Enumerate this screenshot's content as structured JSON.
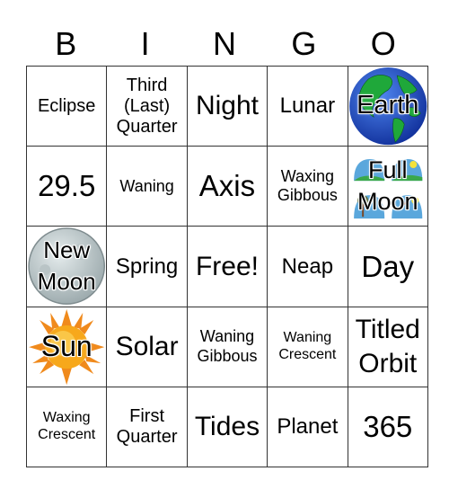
{
  "header": {
    "letters": [
      "B",
      "I",
      "N",
      "G",
      "O"
    ]
  },
  "card": {
    "rows": [
      [
        {
          "text": "Eclipse",
          "size": "sm"
        },
        {
          "text": "Third (Last) Quarter",
          "lines": [
            "Third",
            "(Last)",
            "Quarter"
          ],
          "size": "sm"
        },
        {
          "text": "Night",
          "size": "lg"
        },
        {
          "text": "Lunar",
          "size": "md"
        },
        {
          "text": "Earth",
          "image": "earth-globe-icon"
        }
      ],
      [
        {
          "text": "29.5",
          "size": "xl"
        },
        {
          "text": "Waning",
          "size": "xs"
        },
        {
          "text": "Axis",
          "size": "xl"
        },
        {
          "text": "Waxing Gibbous",
          "lines": [
            "Waxing",
            "Gibbous"
          ],
          "size": "xs"
        },
        {
          "text": "Full Moon",
          "lines": [
            "Full",
            "Moon"
          ],
          "image": "full-moon-landscape-icon"
        }
      ],
      [
        {
          "text": "New Moon",
          "lines": [
            "New",
            "Moon"
          ],
          "image": "moon-icon"
        },
        {
          "text": "Spring",
          "size": "md"
        },
        {
          "text": "Free!",
          "size": "lg"
        },
        {
          "text": "Neap",
          "size": "md"
        },
        {
          "text": "Day",
          "size": "xl"
        }
      ],
      [
        {
          "text": "Sun",
          "image": "sun-icon"
        },
        {
          "text": "Solar",
          "size": "lg"
        },
        {
          "text": "Waning Gibbous",
          "lines": [
            "Waning",
            "Gibbous"
          ],
          "size": "xs"
        },
        {
          "text": "Waning Crescent",
          "lines": [
            "Waning",
            "Crescent"
          ],
          "size": "xxs"
        },
        {
          "text": "Titled Orbit",
          "lines": [
            "Titled",
            "Orbit"
          ],
          "size": "lg"
        }
      ],
      [
        {
          "text": "Waxing Crescent",
          "lines": [
            "Waxing",
            "Crescent"
          ],
          "size": "xxs"
        },
        {
          "text": "First Quarter",
          "lines": [
            "First",
            "Quarter"
          ],
          "size": "sm"
        },
        {
          "text": "Tides",
          "size": "lg"
        },
        {
          "text": "Planet",
          "size": "md"
        },
        {
          "text": "365",
          "size": "xl"
        }
      ]
    ]
  },
  "colors": {
    "grid_line": "#333333",
    "earth_ocean": "#1f4fc8",
    "earth_land": "#1fa83a",
    "sun_core": "#f7a81b",
    "sun_rays": "#f08a1c",
    "moon_gray": "#c6d0d2",
    "sky_blue": "#5aa7dc",
    "grass_green": "#3aa84a"
  }
}
